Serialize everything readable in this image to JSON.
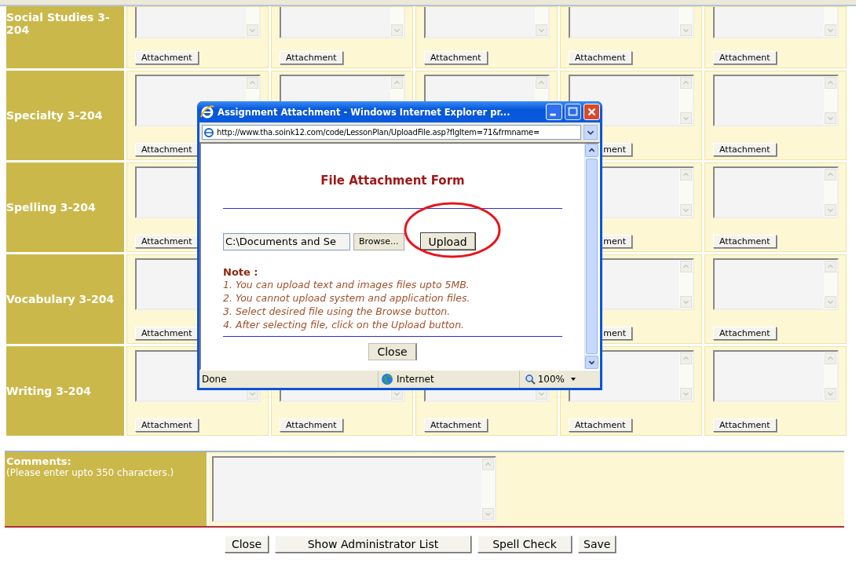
{
  "subjects": [
    {
      "name": "Social Studies 3-204",
      "cut_top": true,
      "cells": [
        {
          "button": "Attachment"
        },
        {
          "button": "Attachment"
        },
        {
          "button": "Attachment"
        },
        {
          "button": "Attachment"
        },
        {
          "button": "Attachment"
        }
      ]
    },
    {
      "name": "Specialty 3-204",
      "cut_top": false,
      "cells": [
        {
          "button": "Attachment"
        },
        {},
        {},
        {
          "button": "ment",
          "cut_left": true
        },
        {
          "button": "Attachment"
        }
      ]
    },
    {
      "name": "Spelling 3-204",
      "cut_top": false,
      "cells": [
        {
          "button": "Attachment"
        },
        {},
        {},
        {
          "button": "ment",
          "cut_left": true
        },
        {
          "button": "Attachment"
        }
      ]
    },
    {
      "name": "Vocabulary 3-204",
      "cut_top": false,
      "cells": [
        {
          "button": "Attachment"
        },
        {},
        {},
        {
          "button": "ment",
          "cut_left": true
        },
        {
          "button": "Attachment"
        }
      ]
    },
    {
      "name": "Writing 3-204",
      "cut_top": false,
      "cells": [
        {
          "button": "Attachment"
        },
        {
          "button": "Attachment"
        },
        {
          "button": "Attachment"
        },
        {
          "button": "Attachment"
        },
        {
          "button": "Attachment"
        }
      ]
    }
  ],
  "comments": {
    "label": "Comments:",
    "hint": "(Please enter upto 350 characters.)"
  },
  "footer_buttons": [
    "Close",
    "Show Administrator List",
    "Spell Check",
    "Save"
  ],
  "popup": {
    "title": "Assignment Attachment - Windows Internet Explorer pr...",
    "url": "http://www.tha.soink12.com/code/LessonPlan/UploadFile.asp?flgItem=71&frmname=",
    "form_title": "File Attachment Form",
    "file_value": "C:\\Documents and Se",
    "browse": "Browse...",
    "upload": "Upload",
    "note_heading": "Note :",
    "notes": [
      "1. You can upload text and images files upto 5MB.",
      "2. You cannot upload system and application files.",
      "3. Select desired file using the Browse button.",
      "4. After selecting file, click on the Upload button."
    ],
    "close": "Close",
    "status": "Done",
    "zone": "Internet",
    "zoom": "100%"
  }
}
